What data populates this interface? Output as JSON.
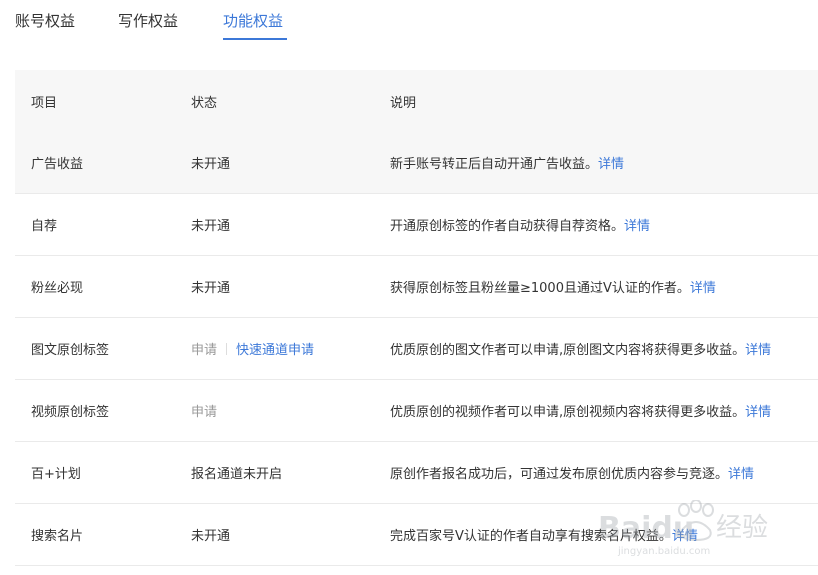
{
  "tabs": [
    {
      "label": "账号权益"
    },
    {
      "label": "写作权益"
    },
    {
      "label": "功能权益",
      "active": true
    }
  ],
  "table": {
    "headers": {
      "item": "项目",
      "status": "状态",
      "desc": "说明"
    },
    "rows": [
      {
        "item": "广告收益",
        "status": "未开通",
        "desc": "新手账号转正后自动开通广告收益。",
        "link": "详情"
      },
      {
        "item": "自荐",
        "status": "未开通",
        "desc": "开通原创标签的作者自动获得自荐资格。",
        "link": "详情"
      },
      {
        "item": "粉丝必现",
        "status": "未开通",
        "desc": "获得原创标签且粉丝量≥1000且通过V认证的作者。",
        "link": "详情"
      },
      {
        "item": "图文原创标签",
        "status": "申请",
        "status_link": "快速通道申请",
        "desc": "优质原创的图文作者可以申请,原创图文内容将获得更多收益。",
        "link": "详情"
      },
      {
        "item": "视频原创标签",
        "status": "申请",
        "desc": "优质原创的视频作者可以申请,原创视频内容将获得更多收益。",
        "link": "详情"
      },
      {
        "item": "百+计划",
        "status": "报名通道未开启",
        "desc": "原创作者报名成功后，可通过发布原创优质内容参与竞逐。",
        "link": "详情"
      },
      {
        "item": "搜索名片",
        "status": "未开通",
        "desc": "完成百家号V认证的作者自动享有搜索名片权益。",
        "link": "详情"
      }
    ]
  },
  "watermark": {
    "brand": "Baidu",
    "cn": "经验",
    "url": "jingyan.baidu.com"
  },
  "colors": {
    "accent": "#3c78d8",
    "header_bg": "#f7f7f7",
    "text": "#333333",
    "muted": "#999999"
  }
}
